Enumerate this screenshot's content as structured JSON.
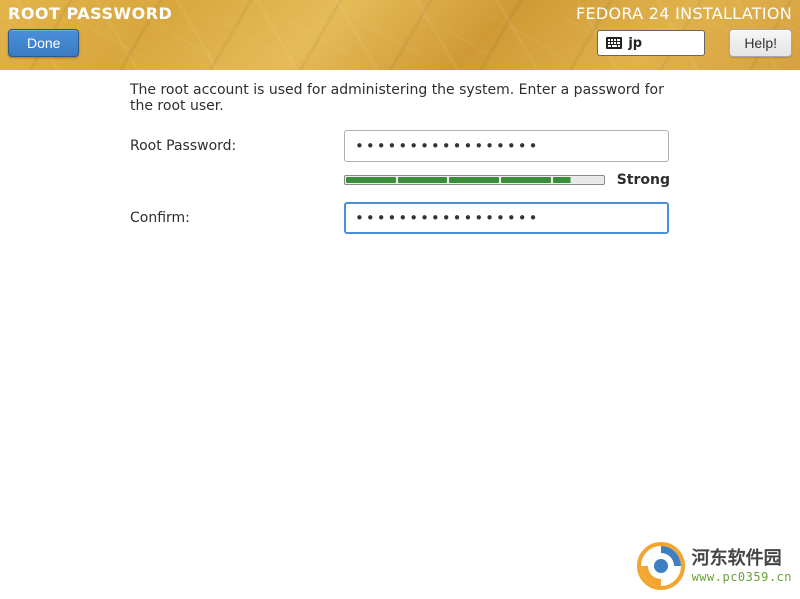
{
  "header": {
    "title": "ROOT PASSWORD",
    "installer": "FEDORA 24 INSTALLATION",
    "done_label": "Done",
    "help_label": "Help!",
    "keyboard_layout": "jp"
  },
  "content": {
    "intro": "The root account is used for administering the system.  Enter a password for the root user.",
    "password_label": "Root Password:",
    "confirm_label": "Confirm:",
    "password_value": "•••••••••••••••••",
    "confirm_value": "•••••••••••••••••",
    "strength_text": "Strong",
    "strength_segments_filled": 4,
    "strength_last_partial": true
  },
  "watermark": {
    "cn_text": "河东软件园",
    "url_text": "www.pc0359.cn"
  },
  "colors": {
    "header_gold": "#d8a73e",
    "accent_blue": "#4a90d9",
    "strength_green": "#3a8e3a"
  }
}
